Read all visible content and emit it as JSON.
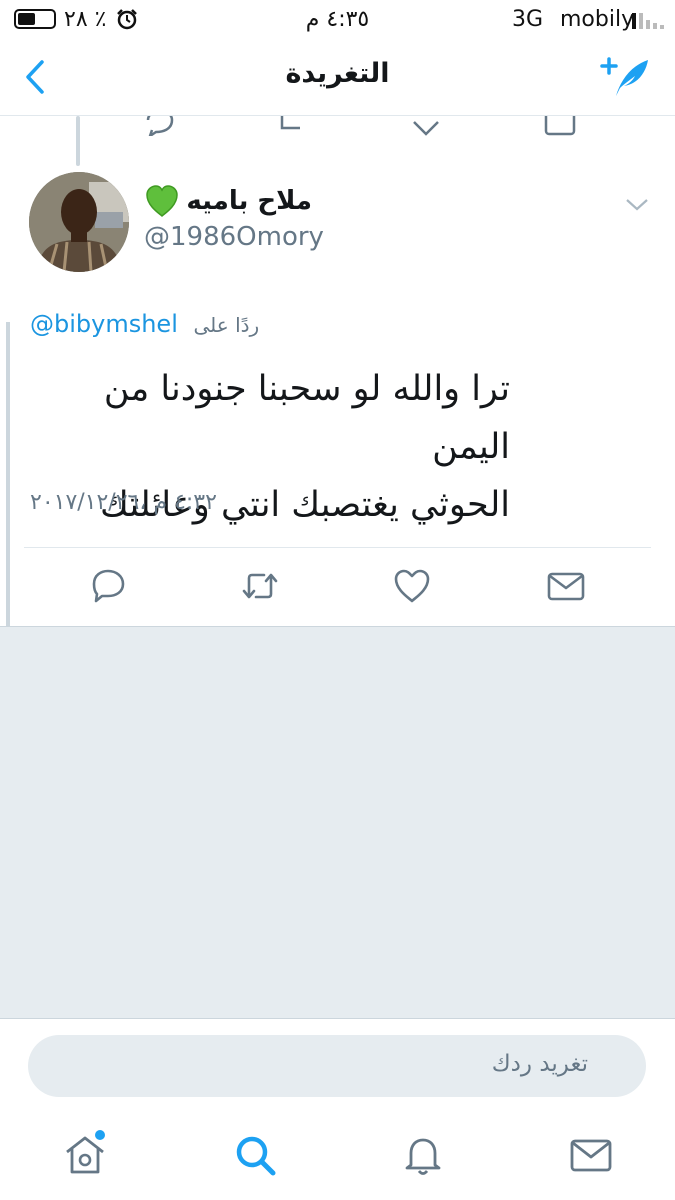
{
  "status_bar": {
    "battery_text": "٪ ٢٨",
    "battery_level": 0.28,
    "time": "٤:٣٥ م",
    "network": "3G",
    "carrier": "mobily"
  },
  "nav": {
    "title": "التغريدة"
  },
  "tweet": {
    "display_name": "ملاح باميه",
    "handle": "@1986Omory",
    "reply_label": "ردًا على",
    "reply_to": "@bibymshel",
    "text_line1": "ترا والله لو سحبنا جنودنا من اليمن",
    "text_line2": "الحوثي يغتصبك انتي وعائلتك",
    "timestamp": "٤:٣٢ م ،٢٠١٧/١٢/٢٦"
  },
  "reply_box": {
    "placeholder": "تغريد ردك"
  },
  "icons": {
    "reply": "reply-icon",
    "retweet": "retweet-icon",
    "like": "heart-icon",
    "dm": "envelope-icon",
    "home": "home-icon",
    "search": "search-icon",
    "notifications": "bell-icon",
    "messages": "mail-icon"
  },
  "colors": {
    "accent": "#1da1f2",
    "mention": "#1b95e0",
    "secondary_text": "#657786",
    "background_gray": "#e6ecf0"
  }
}
